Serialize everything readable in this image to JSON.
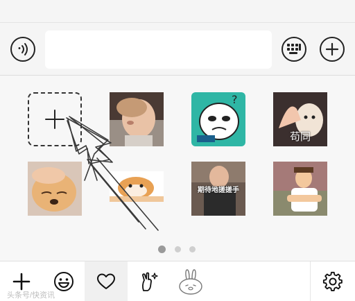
{
  "input_bar": {
    "icons": {
      "voice": "voice-icon",
      "keyboard": "keyboard-icon",
      "more": "plus-circle-icon"
    },
    "text_value": ""
  },
  "sticker_panel": {
    "add_tile_icon": "plus-icon",
    "stickers": [
      {
        "id": "sticker-1",
        "label": ""
      },
      {
        "id": "sticker-2",
        "label": ""
      },
      {
        "id": "sticker-3",
        "label": ""
      },
      {
        "id": "sticker-4",
        "label": "苟同"
      },
      {
        "id": "sticker-5",
        "label": ""
      },
      {
        "id": "sticker-6",
        "label": ""
      },
      {
        "id": "sticker-7",
        "label": "期待地搓搓手"
      },
      {
        "id": "sticker-8",
        "label": ""
      }
    ],
    "pages": 3,
    "current_page": 1
  },
  "tab_bar": {
    "tabs": [
      {
        "icon": "add-icon",
        "selected": false
      },
      {
        "icon": "emoji-icon",
        "selected": false
      },
      {
        "icon": "heart-icon",
        "selected": true
      },
      {
        "icon": "sparkle-hand-icon",
        "selected": false
      },
      {
        "icon": "bunny-sticker-icon",
        "selected": false
      }
    ],
    "settings_icon": "gear-icon",
    "watermark": "头条号/快资讯"
  },
  "colors": {
    "icon_stroke": "#222222",
    "panel_bg": "#f7f7f7",
    "page_dot_active": "#9a9a9a",
    "page_dot": "#cfcfcf"
  }
}
